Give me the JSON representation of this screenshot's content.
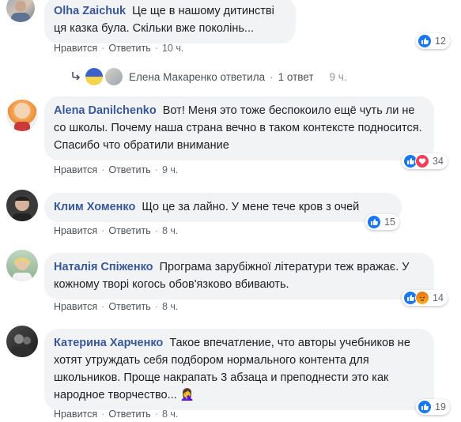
{
  "comments": [
    {
      "author": "Olha Zaichuk",
      "text": "Це ще в нашому дитинстві ця казка була. Скільки вже поколінь...",
      "like_label": "Нравится",
      "reply_label": "Ответить",
      "time": "10 ч.",
      "reactions": [
        "like"
      ],
      "reaction_count": "12"
    },
    {
      "author": "Alena Danilchenko",
      "text": "Вот! Меня это тоже беспокоило ещё чуть ли не со школы. Почему наша страна вечно в таком контексте подносится. Спасибо что обратили внимание",
      "like_label": "Нравится",
      "reply_label": "Ответить",
      "time": "9 ч.",
      "reactions": [
        "like",
        "love"
      ],
      "reaction_count": "34"
    },
    {
      "author": "Клим Хоменко",
      "text": "Що це за лайно. У мене тече кров з очей",
      "like_label": "Нравится",
      "reply_label": "Ответить",
      "time": "8 ч.",
      "reactions": [
        "like"
      ],
      "reaction_count": "15"
    },
    {
      "author": "Наталія Спіженко",
      "text": "Програма зарубіжної літератури теж вражає. У кожному творі когось обов'язково вбивають.",
      "like_label": "Нравится",
      "reply_label": "Ответить",
      "time": "8 ч.",
      "reactions": [
        "like",
        "angry"
      ],
      "reaction_count": "14"
    },
    {
      "author": "Катерина Харченко",
      "text": "Такое впечатление, что авторы учебников не хотят утруждать себя подбором нормального контента для школьников. Проще накрапать 3 абзаца и преподнести это как народное творчество...",
      "emoji": "🤦‍♀️",
      "like_label": "Нравится",
      "reply_label": "Ответить",
      "time": "8 ч.",
      "reactions": [
        "like"
      ],
      "reaction_count": "19"
    }
  ],
  "reply_summary": {
    "text": "Елена Макаренко ответила",
    "count": "1 ответ",
    "time": "9 ч."
  },
  "colors": {
    "name": "#385898",
    "bubble": "#f2f3f5",
    "meta": "#616770",
    "like": "#1877f2",
    "love": "#f33e58",
    "angry": "#e9710f"
  }
}
